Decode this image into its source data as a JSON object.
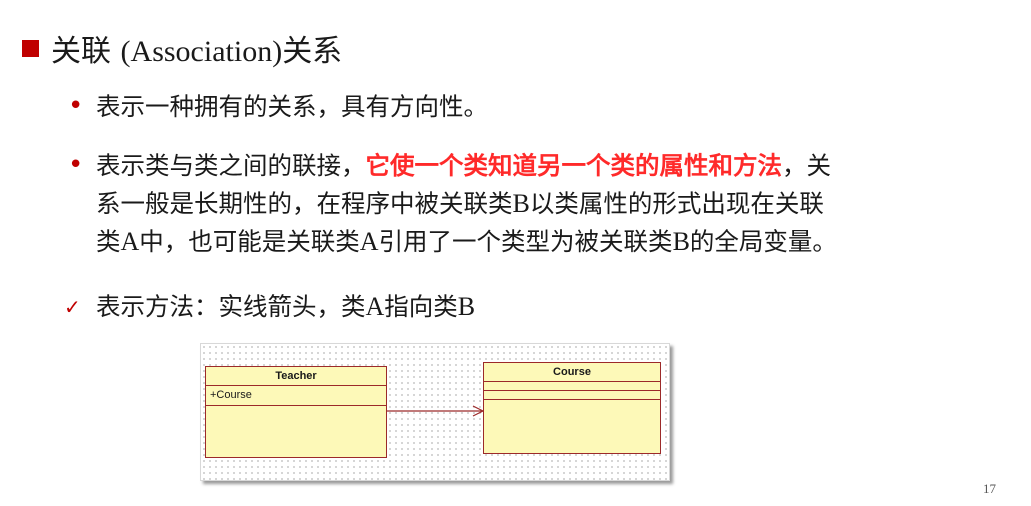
{
  "slide": {
    "title_cn_a": "关联 ",
    "title_latin": "(Association)",
    "title_cn_b": "关系",
    "bullets": {
      "b1": {
        "marker": "•",
        "text": "表示一种拥有的关系，具有方向性。"
      },
      "b2": {
        "marker": "•",
        "text_before": "表示类与类之间的联接，",
        "highlight": "它使一个类知道另一个类的属性和方法",
        "line1_end": "，关",
        "line2_a": "系一般是长期性的，在程序中被关联类",
        "line2_latin": "B",
        "line2_b": "以类属性的形式出现在关联",
        "line3_a": "类",
        "line3_latin_a": "A",
        "line3_b": "中，也可能是关联类",
        "line3_latin_b": "A",
        "line3_c": "引用了一个类型为被关联类",
        "line3_latin_c": "B",
        "line3_d": "的全局变量。"
      },
      "b3": {
        "marker": "✓",
        "text_a": "表示方法：实线箭头，类",
        "latin_a": "A",
        "text_b": "指向类",
        "latin_b": "B"
      }
    },
    "page_number": "17"
  },
  "diagram": {
    "teacher": {
      "name": "Teacher",
      "attribute": "+Course"
    },
    "course": {
      "name": "Course"
    },
    "colors": {
      "class_fill": "#fdf9b8",
      "class_border": "#9c2a2a",
      "arrow": "#9c2a2a",
      "highlight": "#ff2a2a",
      "bullet": "#c00000"
    }
  }
}
